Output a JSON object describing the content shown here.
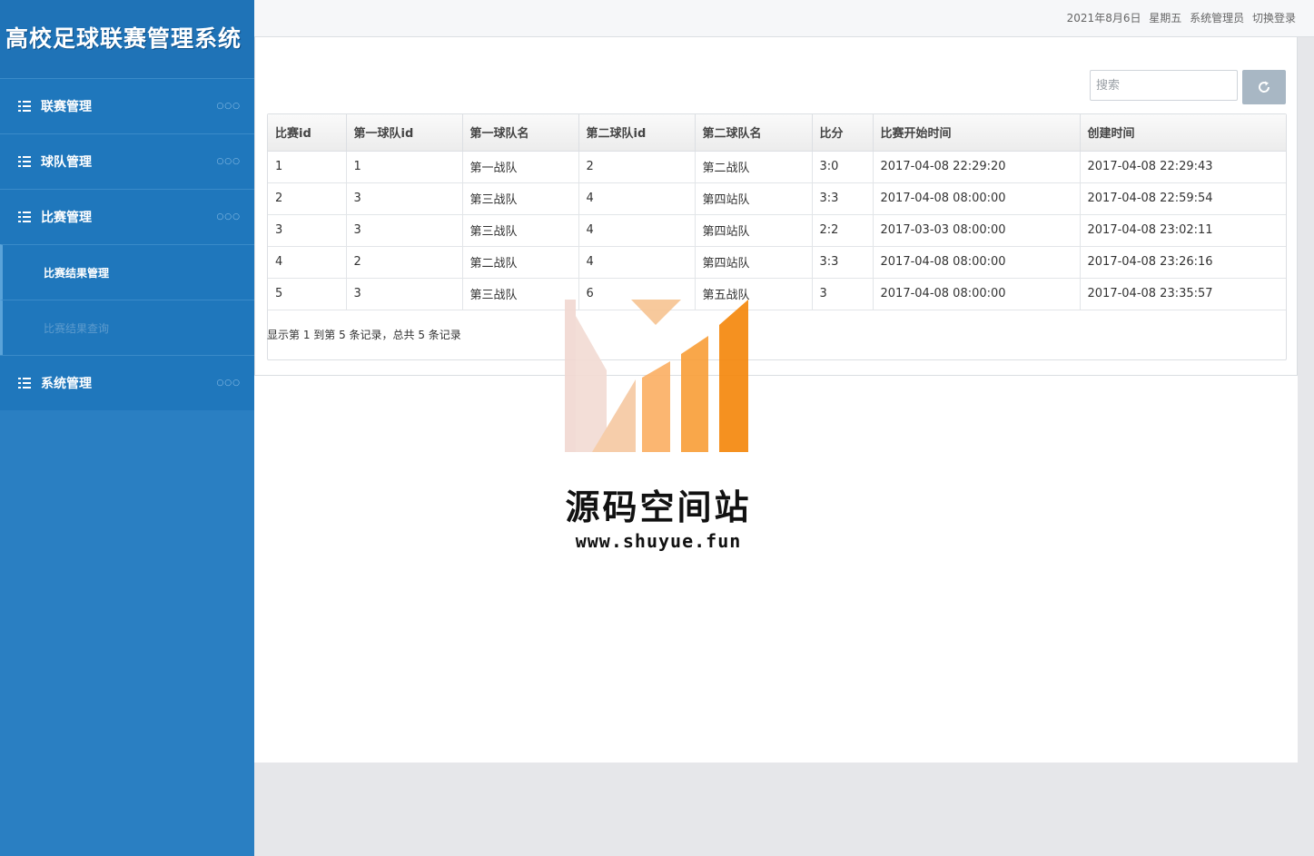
{
  "app": {
    "title": "高校足球联赛管理系统"
  },
  "topbar": {
    "date": "2021年8月6日",
    "weekday": "星期五",
    "user": "系统管理员",
    "logout": "切换登录"
  },
  "sidebar": {
    "items": [
      {
        "label": "联赛管理",
        "dots": "○○○"
      },
      {
        "label": "球队管理",
        "dots": "○○○"
      },
      {
        "label": "比赛管理",
        "dots": "○○○"
      },
      {
        "label": "系统管理",
        "dots": "○○○"
      }
    ],
    "sub_items": [
      {
        "label": "比赛结果管理",
        "active": true
      },
      {
        "label": "比赛结果查询",
        "active": false
      }
    ]
  },
  "search": {
    "placeholder": "搜索"
  },
  "table": {
    "headers": [
      "比赛id",
      "第一球队id",
      "第一球队名",
      "第二球队id",
      "第二球队名",
      "比分",
      "比赛开始时间",
      "创建时间"
    ],
    "rows": [
      [
        "1",
        "1",
        "第一战队",
        "2",
        "第二战队",
        "3:0",
        "2017-04-08 22:29:20",
        "2017-04-08 22:29:43"
      ],
      [
        "2",
        "3",
        "第三战队",
        "4",
        "第四站队",
        "3:3",
        "2017-04-08 08:00:00",
        "2017-04-08 22:59:54"
      ],
      [
        "3",
        "3",
        "第三战队",
        "4",
        "第四站队",
        "2:2",
        "2017-03-03 08:00:00",
        "2017-04-08 23:02:11"
      ],
      [
        "4",
        "2",
        "第二战队",
        "4",
        "第四站队",
        "3:3",
        "2017-04-08 08:00:00",
        "2017-04-08 23:26:16"
      ],
      [
        "5",
        "3",
        "第三战队",
        "6",
        "第五战队",
        "3",
        "2017-04-08 08:00:00",
        "2017-04-08 23:35:57"
      ]
    ]
  },
  "pager": {
    "info": "显示第 1 到第 5 条记录，总共 5 条记录"
  },
  "watermark": {
    "title": "源码空间站",
    "url": "www.shuyue.fun"
  },
  "colors": {
    "sidebar": "#2a7fc2",
    "brand_bar": "#1f73b7",
    "refresh_button": "#a8b7c4"
  }
}
